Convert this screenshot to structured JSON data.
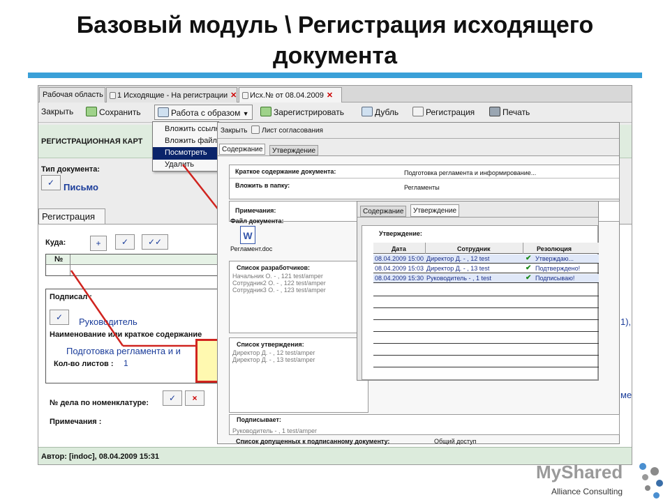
{
  "slide": {
    "title_line1": "Базовый модуль \\ Регистрация исходящего",
    "title_line2": "документа",
    "footer": "Alliance Consulting",
    "logo_text": "MyShared",
    "accent_color": "#3aa0d8"
  },
  "app": {
    "tabs": [
      {
        "label": "Рабочая область"
      },
      {
        "label": "1 Исходящие - На регистрации"
      },
      {
        "label": "Исх.№  от 08.04.2009"
      }
    ],
    "toolbar": {
      "close": "Закрыть",
      "save": "Сохранить",
      "work_with": "Работа с образом",
      "register": "Зарегистрировать",
      "duplicate": "Дубль",
      "registration": "Регистрация",
      "print": "Печать"
    },
    "menu_items": [
      "Вложить ссылк",
      "Вложить файл",
      "Посмотреть",
      "Удалить"
    ],
    "card_title": "РЕГИСТРАЦИОННАЯ КАРТ",
    "doc_type_label": "Тип документа:",
    "doc_type_value": "Письмо",
    "reg_tab": "Регистрация",
    "to_label": "Куда:",
    "to_buttons": [
      "+",
      "✓",
      "✓✓"
    ],
    "num_label": "№",
    "signed_label": "Подписал :",
    "signed_value": "Руководитель",
    "name_label": "Наименование или краткое содержание",
    "name_value": "Подготовка регламента и и",
    "sheets_label": "Кол-во листов :",
    "sheets_value": "1",
    "case_label": "№ дела по номенклатуре:",
    "notes_label": "Примечания :",
    "right_fragment_1": "1),",
    "right_fragment_2": "ме",
    "author_status": "Автор: [indoc], 08.04.2009 15:31"
  },
  "window1": {
    "toolbar_close": "Закрыть",
    "toolbar_sheet": "Лист согласования",
    "tabs": [
      "Содержание",
      "Утверждение"
    ],
    "summary_label": "Краткое содержание документа:",
    "summary_value": "Подготовка регламента и информирование...",
    "folder_label": "Вложить в папку:",
    "folder_value": "Регламенты",
    "notes_label": "Примечания:",
    "file_label": "Файл документа:",
    "file_name": "Регламент.doc",
    "dev_list_label": "Список разработчиков:",
    "dev_list": [
      "Начальник О. - , 121 test/amper",
      "Сотрудник2 О. - , 122 test/amper",
      "Сотрудник3 О. - , 123 test/amper"
    ],
    "approval_list_label": "Список утверждения:",
    "approval_list": [
      "Директор Д. - , 12 test/amper",
      "Директор Д. - , 13 test/amper"
    ],
    "signer_label": "Подписывает:",
    "signer_value": "Руководитель - , 1 test/amper",
    "access_label": "Список допущенных к подписанному документу:",
    "access_value": "Общий доступ"
  },
  "window2": {
    "tabs": [
      "Содержание",
      "Утверждение"
    ],
    "section_label": "Утверждение:",
    "columns": [
      "Дата",
      "Сотрудник",
      "Резолюция"
    ],
    "rows": [
      {
        "date": "08.04.2009 15:00",
        "employee": "Директор Д. - , 12 test",
        "resolution": "Утверждаю..."
      },
      {
        "date": "08.04.2009 15:03",
        "employee": "Директор Д. - , 13 test",
        "resolution": "Подтверждено!"
      },
      {
        "date": "08.04.2009 15:30",
        "employee": "Руководитель - , 1 test",
        "resolution": "Подписываю!"
      }
    ]
  }
}
